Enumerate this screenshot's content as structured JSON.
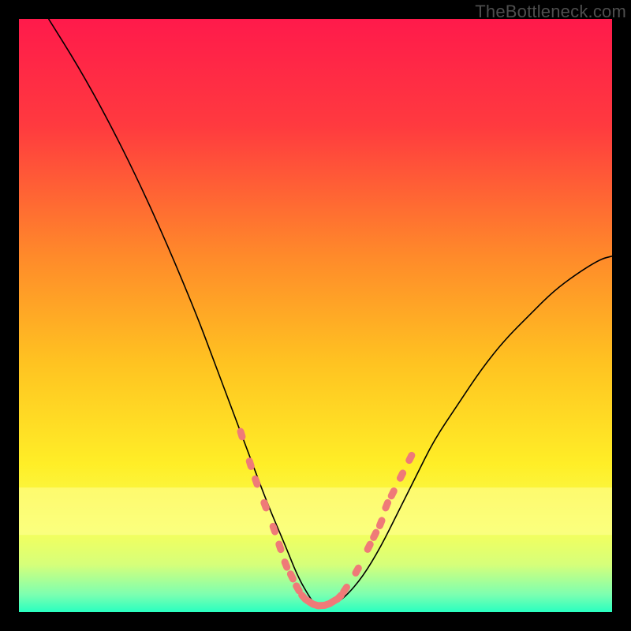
{
  "watermark": "TheBottleneck.com",
  "chart_data": {
    "type": "line",
    "title": "",
    "xlabel": "",
    "ylabel": "",
    "xlim": [
      0,
      100
    ],
    "ylim": [
      0,
      100
    ],
    "grid": false,
    "legend": false,
    "background_gradient": {
      "stops": [
        {
          "offset": 0.0,
          "color": "#ff1a4b"
        },
        {
          "offset": 0.18,
          "color": "#ff3a3f"
        },
        {
          "offset": 0.4,
          "color": "#ff8a2a"
        },
        {
          "offset": 0.58,
          "color": "#ffc321"
        },
        {
          "offset": 0.75,
          "color": "#ffee27"
        },
        {
          "offset": 0.86,
          "color": "#f7ff5a"
        },
        {
          "offset": 0.92,
          "color": "#d6ff7a"
        },
        {
          "offset": 0.97,
          "color": "#7dffb0"
        },
        {
          "offset": 1.0,
          "color": "#29ffc0"
        }
      ],
      "highlight_band": {
        "y0": 79,
        "y1": 87,
        "color": "#ffff99"
      }
    },
    "series": [
      {
        "name": "curve",
        "stroke": "#000000",
        "stroke_width": 1.6,
        "x": [
          5,
          10,
          15,
          20,
          25,
          30,
          33,
          36,
          39,
          42,
          45,
          47,
          49,
          50,
          51,
          53,
          55,
          58,
          61,
          64,
          67,
          70,
          74,
          78,
          82,
          86,
          90,
          94,
          98,
          100
        ],
        "y": [
          100,
          92,
          83,
          73,
          62,
          50,
          42,
          34,
          26,
          18,
          11,
          6,
          2.5,
          1.2,
          1,
          1.3,
          2.5,
          6,
          11,
          17,
          23,
          29,
          35,
          41,
          46,
          50,
          54,
          57,
          59.5,
          60
        ]
      }
    ],
    "marker_series": {
      "name": "data-points",
      "shape": "rounded-dash",
      "fill": "#ef7a78",
      "points": [
        {
          "x": 37.5,
          "y": 30
        },
        {
          "x": 39.0,
          "y": 25
        },
        {
          "x": 40.0,
          "y": 22
        },
        {
          "x": 41.5,
          "y": 18
        },
        {
          "x": 43.0,
          "y": 14
        },
        {
          "x": 44.0,
          "y": 11
        },
        {
          "x": 45.0,
          "y": 8
        },
        {
          "x": 46.0,
          "y": 6
        },
        {
          "x": 47.0,
          "y": 4
        },
        {
          "x": 48.0,
          "y": 2.5
        },
        {
          "x": 49.0,
          "y": 1.7
        },
        {
          "x": 50.0,
          "y": 1.2
        },
        {
          "x": 51.0,
          "y": 1.1
        },
        {
          "x": 52.0,
          "y": 1.3
        },
        {
          "x": 53.0,
          "y": 1.8
        },
        {
          "x": 54.0,
          "y": 2.5
        },
        {
          "x": 55.0,
          "y": 3.8
        },
        {
          "x": 57.0,
          "y": 7
        },
        {
          "x": 59.0,
          "y": 11
        },
        {
          "x": 60.0,
          "y": 13
        },
        {
          "x": 61.0,
          "y": 15
        },
        {
          "x": 62.0,
          "y": 18
        },
        {
          "x": 63.0,
          "y": 20
        },
        {
          "x": 64.5,
          "y": 23
        },
        {
          "x": 66.0,
          "y": 26
        }
      ]
    }
  }
}
